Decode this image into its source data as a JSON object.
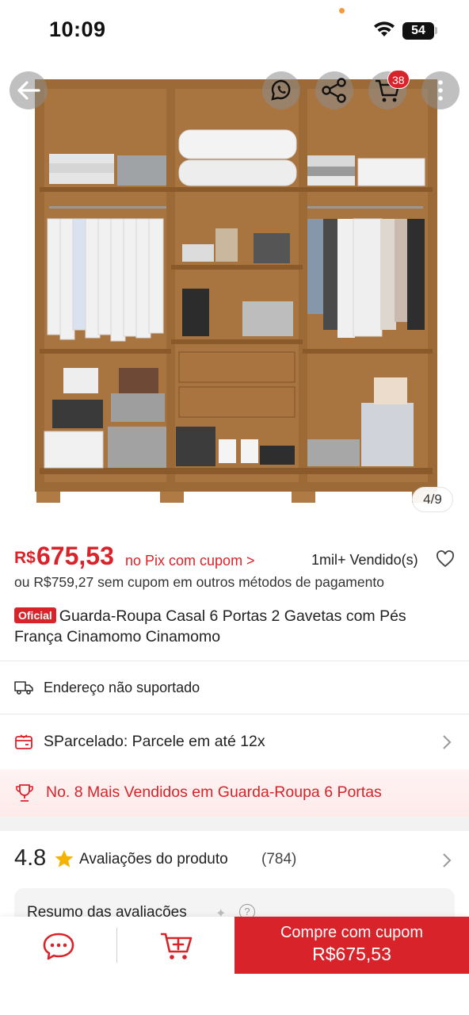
{
  "status_bar": {
    "time": "10:09",
    "battery": "54"
  },
  "hero": {
    "image_counter": "4/9",
    "cart_badge": "38"
  },
  "price": {
    "currency": "R$",
    "value": "675,53",
    "pix_label": "no Pix com cupom >",
    "sold": "1mil+ Vendido(s)",
    "alt_price": "ou R$759,27 sem cupom em outros métodos de pagamento"
  },
  "product": {
    "badge": "Oficial",
    "title": "Guarda-Roupa Casal 6 Portas 2 Gavetas com Pés França Cinamomo Cinamomo"
  },
  "shipping": {
    "text": "Endereço não suportado"
  },
  "installments": {
    "text": "SParcelado: Parcele em até 12x"
  },
  "ranking": {
    "text": "No. 8 Mais Vendidos em Guarda-Roupa 6 Portas"
  },
  "rating": {
    "score": "4.8",
    "label": "Avaliações do produto",
    "count": "(784)"
  },
  "reviews_summary": {
    "title": "Resumo das avaliações"
  },
  "bottom_bar": {
    "buy_label": "Compre com cupom",
    "buy_price": "R$675,53"
  },
  "colors": {
    "accent": "#d8232a",
    "wood": "#9c6a36"
  },
  "icons": [
    "back-arrow-icon",
    "whatsapp-icon",
    "share-icon",
    "cart-icon",
    "more-icon",
    "heart-icon",
    "truck-icon",
    "card-icon",
    "trophy-icon",
    "star-icon",
    "chevron-right-icon",
    "chat-icon",
    "add-cart-icon"
  ]
}
